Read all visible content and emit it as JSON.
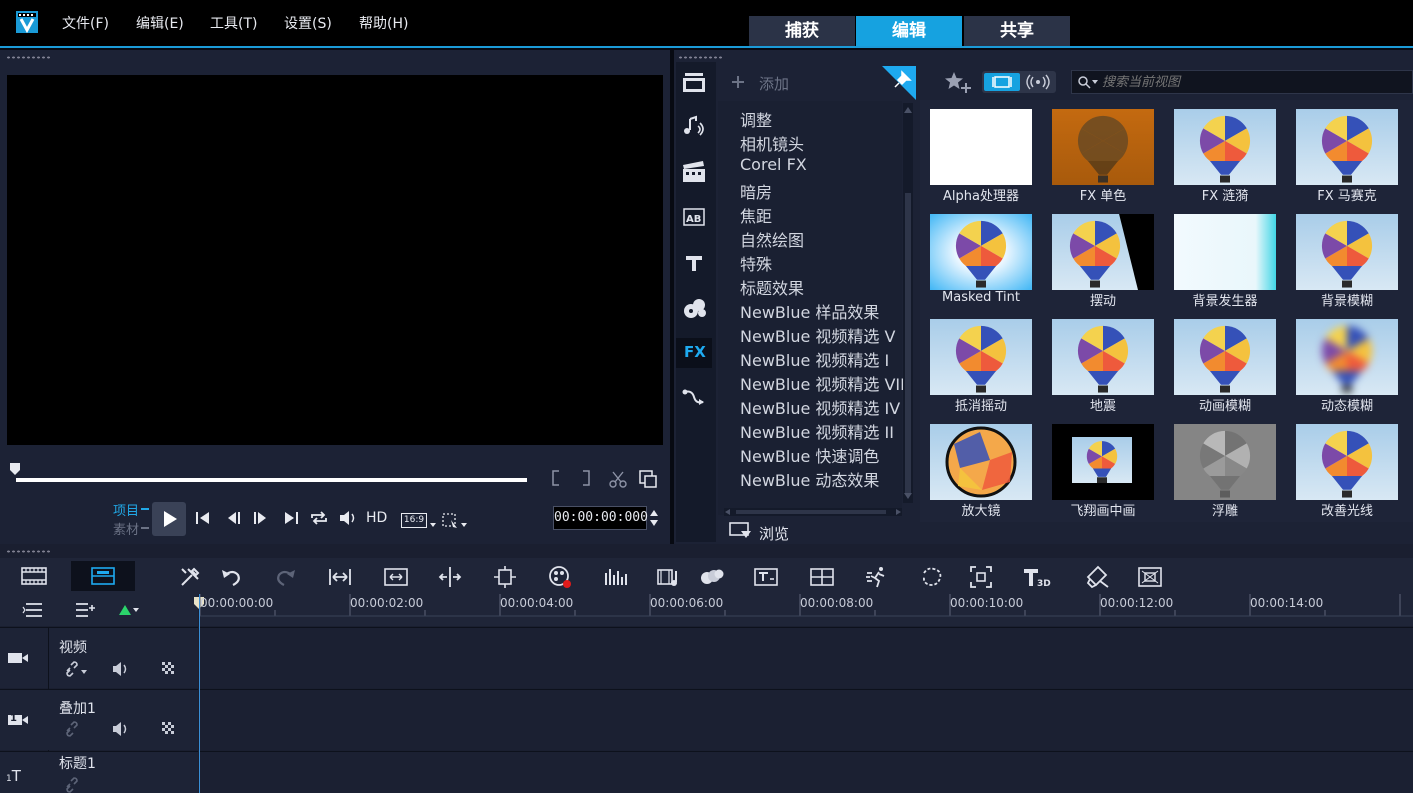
{
  "menu": {
    "items": [
      "文件(F)",
      "编辑(E)",
      "工具(T)",
      "设置(S)",
      "帮助(H)"
    ]
  },
  "modes": {
    "tabs": [
      "捕获",
      "编辑",
      "共享"
    ],
    "active": "编辑"
  },
  "player": {
    "project_label": "项目",
    "clip_label": "素材",
    "hd_label": "HD",
    "aspect_label": "16:9",
    "timecode": "00:00:00:000"
  },
  "library": {
    "add_label": "添加",
    "browse_label": "浏览",
    "search_placeholder": "搜索当前视图",
    "categories": [
      "调整",
      "相机镜头",
      "Corel FX",
      "暗房",
      "焦距",
      "自然绘图",
      "特殊",
      "标题效果",
      "NewBlue 样品效果",
      "NewBlue 视频精选 V",
      "NewBlue 视频精选 I",
      "NewBlue 视频精选 VII",
      "NewBlue 视频精选 IV",
      "NewBlue 视频精选 II",
      "NewBlue 快速调色",
      "NewBlue 动态效果"
    ],
    "side_fx_label": "FX",
    "effects": [
      {
        "label": "Alpha处理器",
        "style": "white"
      },
      {
        "label": "FX 单色",
        "style": "mono"
      },
      {
        "label": "FX 涟漪",
        "style": "balloon"
      },
      {
        "label": "FX 马赛克",
        "style": "balloon"
      },
      {
        "label": "Masked Tint",
        "style": "tint"
      },
      {
        "label": "摆动",
        "style": "swing"
      },
      {
        "label": "背景发生器",
        "style": "bggen"
      },
      {
        "label": "背景模糊",
        "style": "balloon"
      },
      {
        "label": "抵消摇动",
        "style": "balloon"
      },
      {
        "label": "地震",
        "style": "balloon"
      },
      {
        "label": "动画模糊",
        "style": "balloon"
      },
      {
        "label": "动态模糊",
        "style": "blur"
      },
      {
        "label": "放大镜",
        "style": "magnify"
      },
      {
        "label": "飞翔画中画",
        "style": "pip"
      },
      {
        "label": "浮雕",
        "style": "emboss"
      },
      {
        "label": "改善光线",
        "style": "balloon"
      }
    ]
  },
  "timeline": {
    "ruler": [
      "00:00:00:00",
      "00:00:02:00",
      "00:00:04:00",
      "00:00:06:00",
      "00:00:08:00",
      "00:00:10:00",
      "00:00:12:00",
      "00:00:14:00"
    ],
    "tracks": [
      {
        "name": "视频",
        "icon": "video-camera-icon"
      },
      {
        "name": "叠加1",
        "icon": "overlay-track-icon"
      },
      {
        "name": "标题1",
        "icon": "title-track-icon"
      }
    ],
    "side_badge_1": "1",
    "title_track_glyph": "T"
  },
  "colors": {
    "accent": "#16a2e0",
    "panel": "#1c2235",
    "background": "#070a12"
  }
}
